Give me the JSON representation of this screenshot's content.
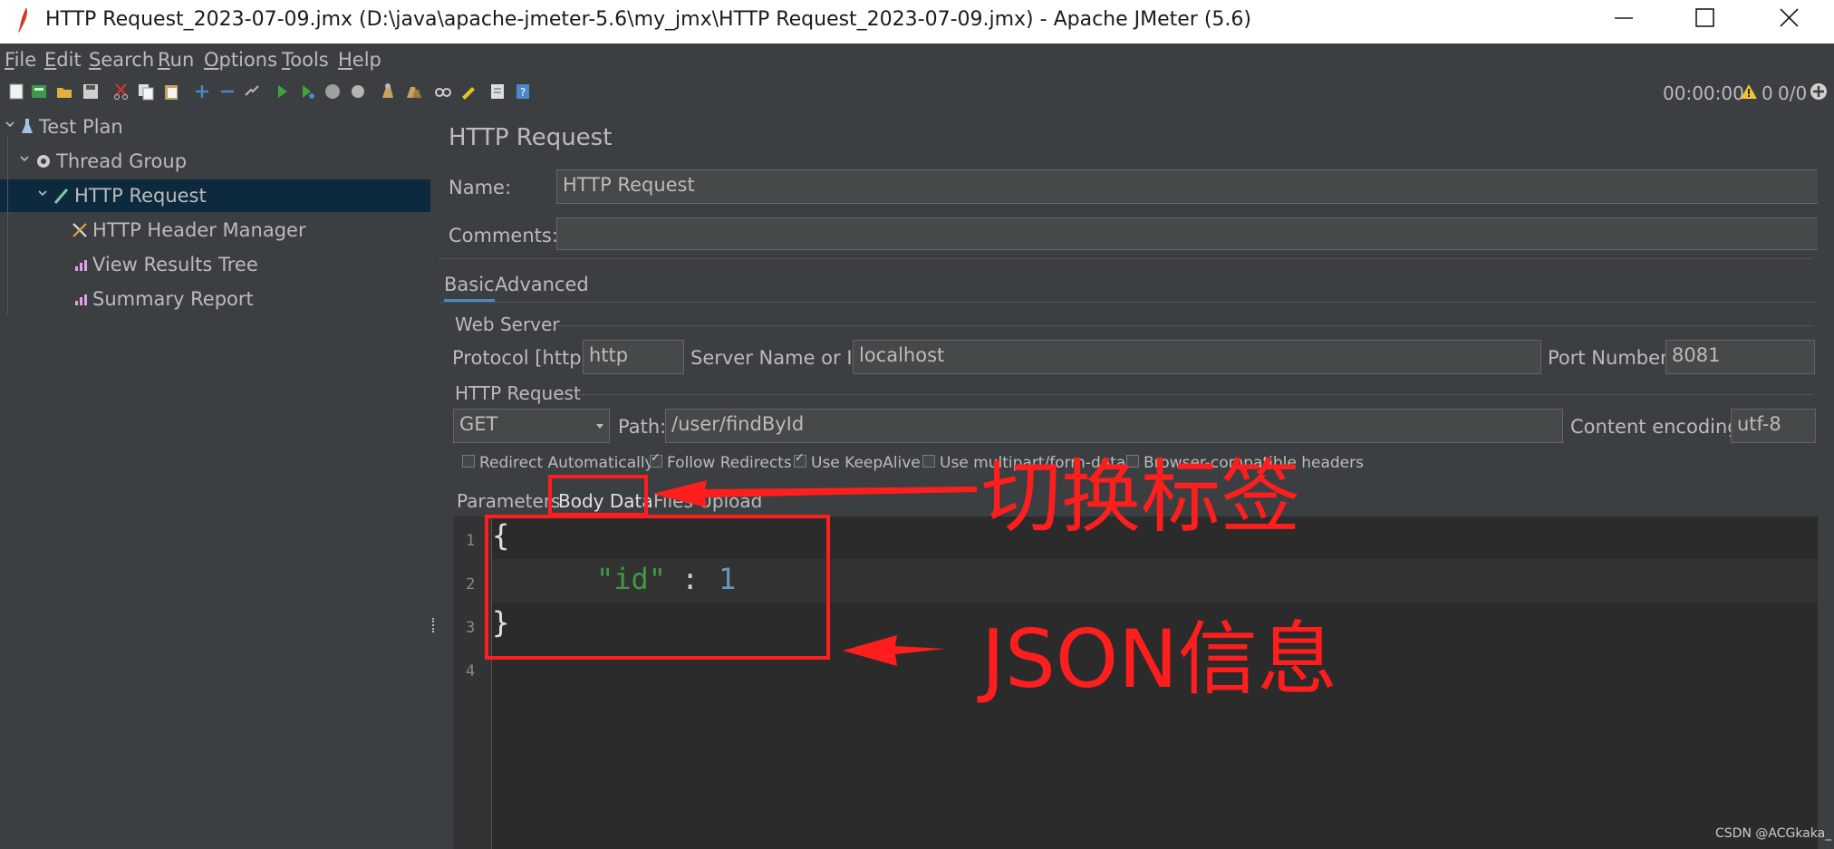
{
  "window": {
    "title": "HTTP Request_2023-07-09.jmx (D:\\java\\apache-jmeter-5.6\\my_jmx\\HTTP Request_2023-07-09.jmx) - Apache JMeter (5.6)"
  },
  "menu": [
    {
      "first": "F",
      "rest": "ile"
    },
    {
      "first": "E",
      "rest": "dit"
    },
    {
      "first": "S",
      "rest": "earch"
    },
    {
      "first": "R",
      "rest": "un"
    },
    {
      "first": "O",
      "rest": "ptions"
    },
    {
      "first": "T",
      "rest": "ools"
    },
    {
      "first": "H",
      "rest": "elp"
    }
  ],
  "status": {
    "timer": "00:00:00",
    "warnings": "0",
    "threads": "0/0"
  },
  "tree": [
    {
      "label": "Test Plan",
      "icon": "flask-icon"
    },
    {
      "label": "Thread Group",
      "icon": "gear-icon"
    },
    {
      "label": "HTTP Request",
      "icon": "pipette-icon"
    },
    {
      "label": "HTTP Header Manager",
      "icon": "tools-icon"
    },
    {
      "label": "View Results Tree",
      "icon": "chart-icon"
    },
    {
      "label": "Summary Report",
      "icon": "chart-icon"
    }
  ],
  "panel": {
    "title": "HTTP Request",
    "name_label": "Name:",
    "name_value": "HTTP Request",
    "comments_label": "Comments:",
    "comments_value": "",
    "tabs": [
      "Basic",
      "Advanced"
    ],
    "web_server": {
      "legend": "Web Server",
      "protocol_label": "Protocol [http]:",
      "protocol_value": "http",
      "server_label": "Server Name or IP:",
      "server_value": "localhost",
      "port_label": "Port Number:",
      "port_value": "8081"
    },
    "http_request": {
      "legend": "HTTP Request",
      "method": "GET",
      "path_label": "Path:",
      "path_value": "/user/findById",
      "encoding_label": "Content encoding:",
      "encoding_value": "utf-8"
    },
    "checkboxes": [
      {
        "label": "Redirect Automatically",
        "checked": false
      },
      {
        "label": "Follow Redirects",
        "checked": true
      },
      {
        "label": "Use KeepAlive",
        "checked": true
      },
      {
        "label": "Use multipart/form-data",
        "checked": false
      },
      {
        "label": "Browser-compatible headers",
        "checked": false
      }
    ],
    "subtabs": [
      "Parameters",
      "Body Data",
      "Files Upload"
    ],
    "body": {
      "line_numbers": [
        "1",
        "2",
        "3",
        "4"
      ],
      "open_brace": "{",
      "key": "\"id\"",
      "colon": ":",
      "value": "1",
      "close_brace": "}"
    }
  },
  "annotations": {
    "tab_note": "切换标签",
    "json_note": "JSON信息"
  },
  "watermark": "CSDN @ACGkaka_",
  "colors": {
    "annotation": "#ff1e1e",
    "selection": "#0d293e",
    "json_key": "#3f9a3f",
    "json_value": "#6897bb"
  }
}
